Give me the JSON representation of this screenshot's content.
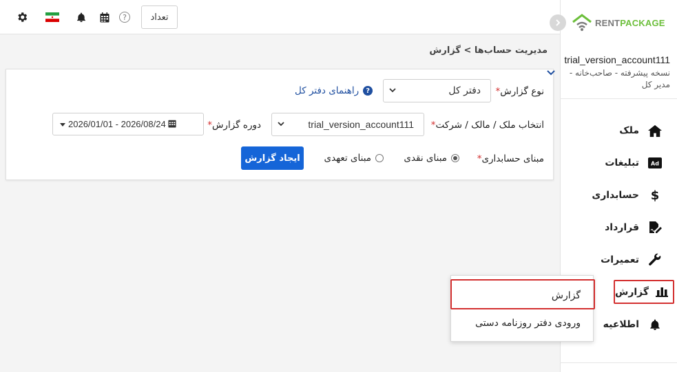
{
  "topbar": {
    "count_button": "تعداد",
    "icons": [
      "gear-icon",
      "iran-flag-icon",
      "bell-icon",
      "calendar-icon",
      "help-icon"
    ],
    "help_glyph": "?"
  },
  "logo": {
    "rent": "RENT",
    "package": "PACKAGE"
  },
  "account": {
    "name": "trial_version_account111",
    "subtitle": "نسخه پیشرفته - صاحب‌خانه - مدیر کل"
  },
  "breadcrumb": "مدیریت حساب‌ها > گزارش",
  "sidebar": {
    "items": [
      {
        "label": "ملک",
        "icon": "home-icon"
      },
      {
        "label": "تبلیغات",
        "icon": "ad-icon"
      },
      {
        "label": "حسابداری",
        "icon": "dollar-icon"
      },
      {
        "label": "قرارداد",
        "icon": "contract-icon"
      },
      {
        "label": "تعمیرات",
        "icon": "wrench-icon"
      },
      {
        "label": "گزارش",
        "icon": "chart-bar-icon"
      },
      {
        "label": "اطلاعیه",
        "icon": "bell-icon"
      }
    ]
  },
  "popup": {
    "items": [
      "گزارش",
      "ورودی دفتر روزنامه دستی"
    ]
  },
  "form": {
    "report_type_label": "نوع گزارش",
    "report_type_value": "دفتر کل",
    "help_link": "راهنمای دفتر کل",
    "property_label": "انتخاب ملک / مالک / شرکت",
    "property_value": "trial_version_account111",
    "period_label": "دوره گزارش",
    "period_value": "2026/01/01 - 2026/08/24",
    "basis_label": "مبنای حسابداری",
    "basis_cash": "مبنای نقدی",
    "basis_accrual": "مبنای تعهدی",
    "basis_selected": "cash",
    "create_button": "ایجاد گزارش",
    "required_mark": "*"
  },
  "colors": {
    "accent": "#1565d8",
    "highlight": "#d32f2f",
    "logo_green": "#6cbf3b"
  }
}
